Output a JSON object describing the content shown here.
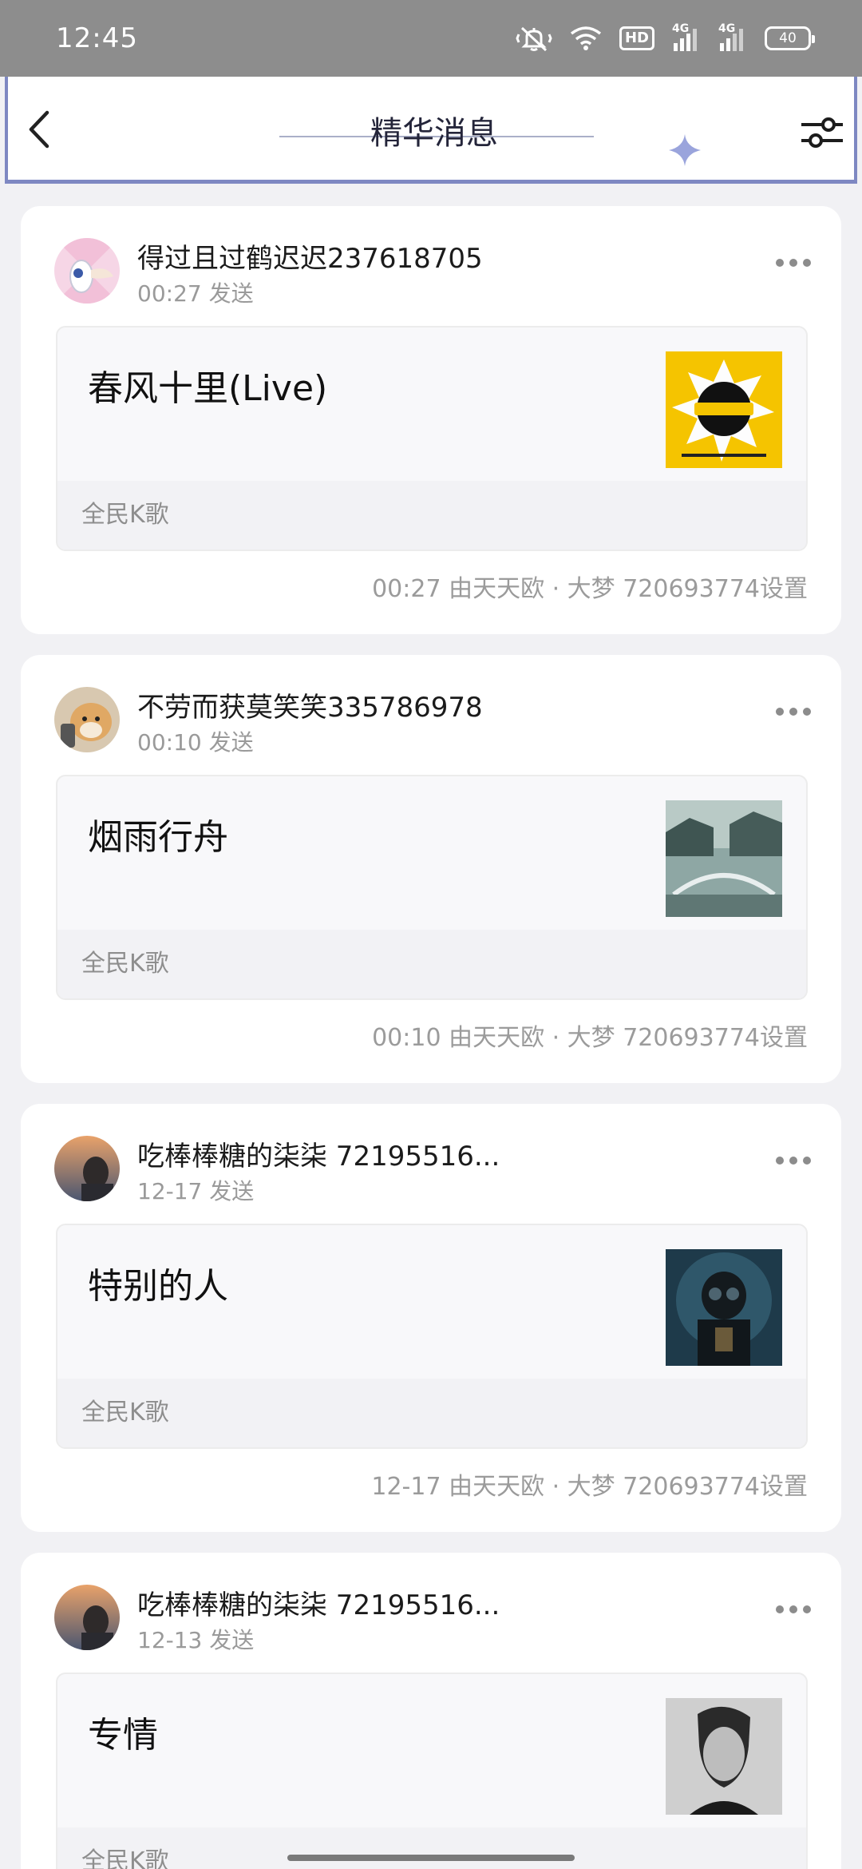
{
  "status_bar": {
    "time": "12:45",
    "hd_label": "HD",
    "network_1": "4G",
    "network_2": "4G",
    "battery": "40"
  },
  "header": {
    "title": "精华消息"
  },
  "colors": {
    "header_accent": "#7e88c2",
    "card_bg": "#ffffff",
    "page_bg": "#f1f1f4"
  },
  "posts": [
    {
      "user": "得过且过鹤迟迟237618705",
      "send_time": "00:27 发送",
      "media_title": "春风十里(Live)",
      "source": "全民K歌",
      "set_info": "00:27 由天天欧 · 大梦 720693774设置",
      "thumb_icon": "album-cover-yellow"
    },
    {
      "user": "不劳而获莫笑笑335786978",
      "send_time": "00:10 发送",
      "media_title": "烟雨行舟",
      "source": "全民K歌",
      "set_info": "00:10 由天天欧 · 大梦 720693774设置",
      "thumb_icon": "album-cover-landscape"
    },
    {
      "user": "吃棒棒糖的柒柒 72195516...",
      "send_time": "12-17 发送",
      "media_title": "特别的人",
      "source": "全民K歌",
      "set_info": "12-17 由天天欧 · 大梦 720693774设置",
      "thumb_icon": "album-cover-dark"
    },
    {
      "user": "吃棒棒糖的柒柒 72195516...",
      "send_time": "12-13 发送",
      "media_title": "专情",
      "source": "全民K歌",
      "set_info": "",
      "thumb_icon": "album-cover-portrait"
    }
  ]
}
